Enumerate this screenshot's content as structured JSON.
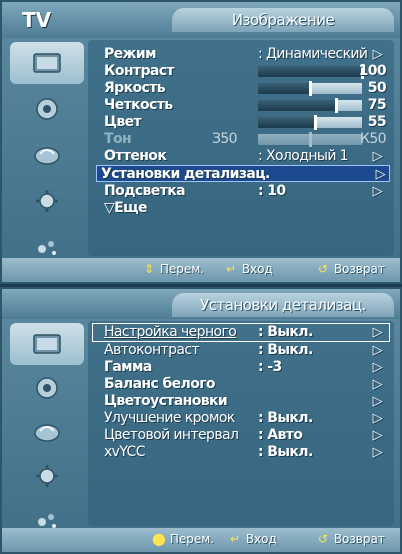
{
  "tv_label": "TV",
  "menu1": {
    "title": "Изображение",
    "rows": [
      {
        "label": "Режим",
        "value": ": Динамический",
        "arrow": "▷"
      },
      {
        "label": "Контраст",
        "number": "100",
        "level": 100
      },
      {
        "label": "Яркость",
        "number": "50",
        "level": 50
      },
      {
        "label": "Четкость",
        "number": "75",
        "level": 75
      },
      {
        "label": "Цвет",
        "number": "55",
        "level": 55
      },
      {
        "label": "Тон",
        "tint_left": "З50",
        "tint_right": "К50",
        "level": 50
      },
      {
        "label": "Оттенок",
        "value": ": Холодный 1",
        "arrow": "▷"
      },
      {
        "label": "Установки детализац.",
        "arrow": "▷"
      },
      {
        "label": "Подсветка",
        "value": ": 10",
        "arrow": "▷"
      },
      {
        "label": "▽Еще"
      }
    ]
  },
  "menu2": {
    "title": "Установки детализац.",
    "rows": [
      {
        "label": "Настройка черного",
        "value": ": Выкл.",
        "arrow": "▷"
      },
      {
        "label": "Автоконтраст",
        "value": ": Выкл.",
        "arrow": "▷"
      },
      {
        "label": "Гамма",
        "value": ": -3",
        "arrow": "▷"
      },
      {
        "label": "Баланс белого",
        "arrow": "▷"
      },
      {
        "label": "Цветоустановки",
        "arrow": "▷"
      },
      {
        "label": "Улучшение кромок",
        "value": ": Выкл.",
        "arrow": "▷"
      },
      {
        "label": "Цветовой интервал",
        "value": ": Авто",
        "arrow": "▷"
      },
      {
        "label": "xvYCC",
        "value": ": Выкл.",
        "arrow": "▷"
      }
    ]
  },
  "footer1": {
    "move": "Перем.",
    "enter": "Вход",
    "return": "Возврат"
  },
  "footer2": {
    "move": "Перем.",
    "enter": "Вход",
    "return": "Возврат"
  },
  "icons": [
    "picture-icon",
    "sound-icon",
    "channel-icon",
    "setup-icon",
    "input-icon"
  ]
}
